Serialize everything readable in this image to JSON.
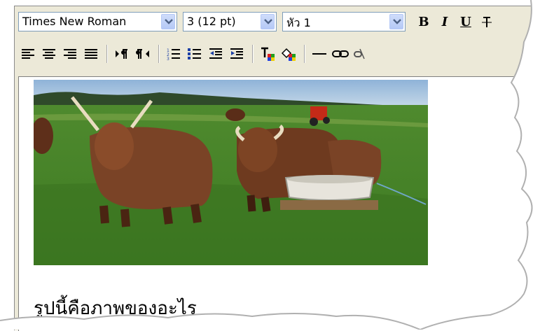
{
  "toolbar": {
    "font_name": "Times New Roman",
    "font_size": "3 (12 pt)",
    "heading": "หัว 1",
    "bold_label": "B",
    "italic_label": "I",
    "underline_label": "U",
    "row2_icons": [
      "align-left-icon",
      "align-center-icon",
      "align-right-icon",
      "align-justify-icon",
      "ltr-icon",
      "rtl-icon",
      "ordered-list-icon",
      "unordered-list-icon",
      "outdent-icon",
      "indent-icon",
      "text-color-icon",
      "background-color-icon",
      "horizontal-rule-icon",
      "link-icon",
      "unlink-icon"
    ]
  },
  "content": {
    "caption": "รูปนี้คือภาพของอะไร"
  },
  "colors": {
    "toolbar_bg": "#ece9d8",
    "select_border": "#7f9db9",
    "icon_blue": "#1c3fa6"
  }
}
